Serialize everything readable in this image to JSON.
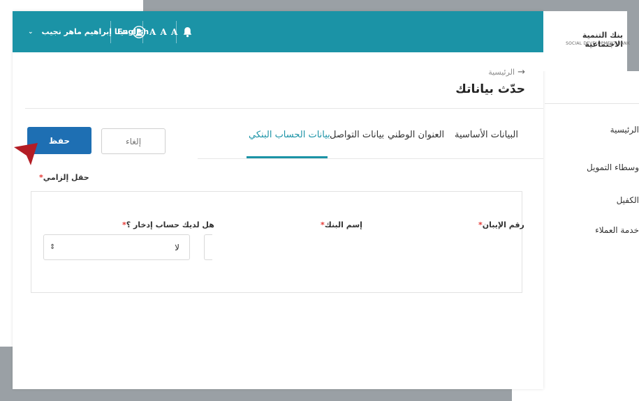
{
  "header": {
    "user_name": "مينا إبراهيم ماهر نجيب",
    "language_toggle": "English",
    "font_size_control": "A A A",
    "icons": [
      "chevron-down-icon",
      "user-icon",
      "bell-icon"
    ]
  },
  "logo": {
    "arabic": "بنك التنمية الاجتماعية",
    "english": "SOCIAL DEVELOPMENT BANK"
  },
  "sidebar": {
    "items": [
      {
        "label": "الرئيسية"
      },
      {
        "label": "وسطاء التمويل"
      },
      {
        "label": "الكفيل"
      },
      {
        "label": "خدمة العملاء"
      }
    ]
  },
  "breadcrumb": {
    "label": "الرئيسية"
  },
  "page": {
    "title": "حدّث بياناتك"
  },
  "tabs": [
    {
      "label": "البيانات الأساسية"
    },
    {
      "label": "العنوان الوطني"
    },
    {
      "label": "بيانات التواصل"
    },
    {
      "label": "بيانات الحساب البنكي",
      "active": true
    }
  ],
  "actions": {
    "save_label": "حفظ",
    "cancel_label": "إلغاء"
  },
  "form": {
    "required_note": "حقل إلزامي",
    "required_marker": "*",
    "fields": {
      "iban_label": "رقم الإيبان",
      "bank_name_label": "إسم البنك",
      "savings_label": "هل لديك حساب إدخار ؟",
      "savings_value": "لا"
    }
  },
  "colors": {
    "primary": "#1b93a6",
    "save_button": "#1e6fb3",
    "required": "#e53935"
  }
}
